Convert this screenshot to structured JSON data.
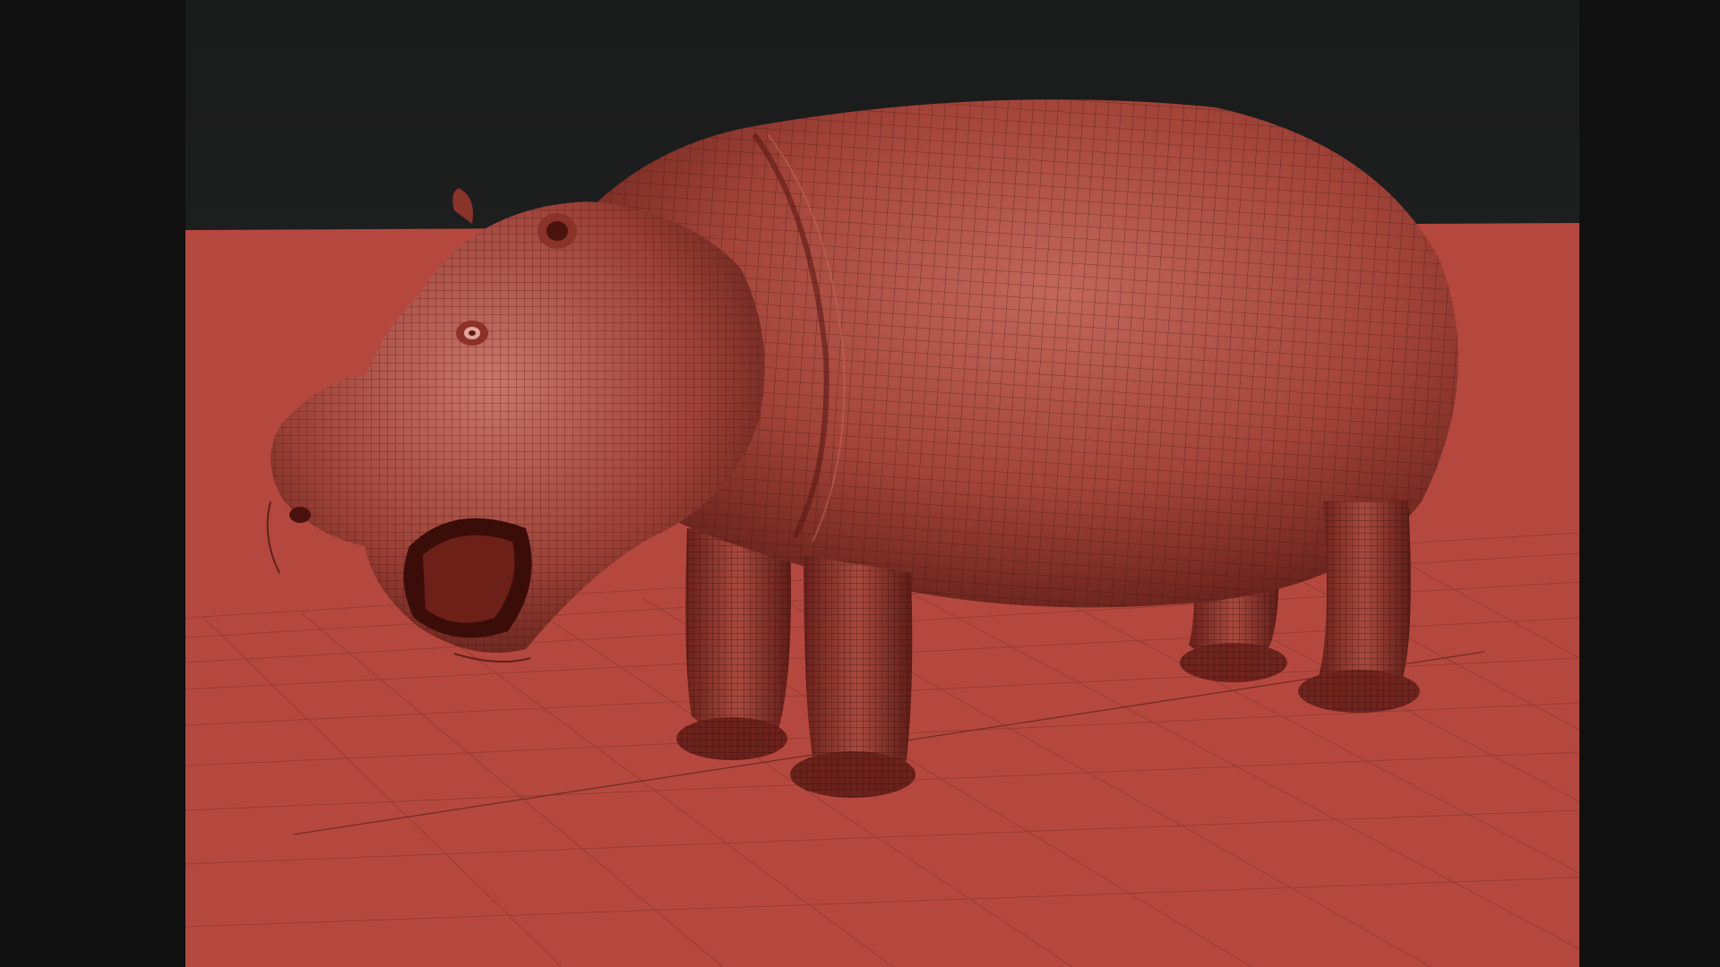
{
  "app": {
    "view": "3D viewport",
    "subject": "hippopotamus-model",
    "display_mode": "polyframe-wireframe-on-shaded"
  },
  "colors": {
    "letterbox": "#111111",
    "background_top": "#1e1f1f",
    "floor": "#b5483e",
    "floor_grid_line": "#8e3a33",
    "model_base": "#a8463c",
    "model_shadow": "#5e1c16",
    "model_highlight": "#c86a5e",
    "wire": "#3c0f0b"
  },
  "icons": {
    "floor_grid": "floor-grid-icon",
    "model": "hippo-model-icon"
  }
}
